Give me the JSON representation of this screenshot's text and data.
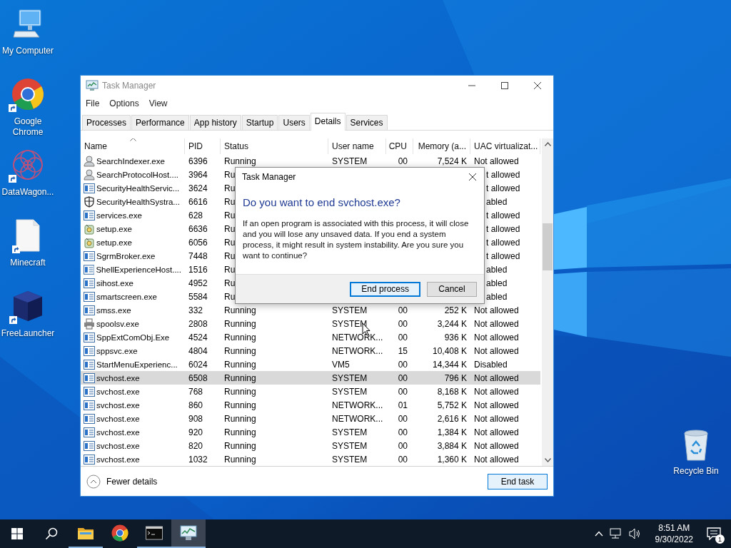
{
  "desktop_icons": [
    {
      "label": "My Computer",
      "kind": "computer",
      "shortcut": false
    },
    {
      "label": "Google Chrome",
      "kind": "chrome",
      "shortcut": true
    },
    {
      "label": "DataWagon...",
      "kind": "pattern",
      "shortcut": true
    },
    {
      "label": "Minecraft",
      "kind": "file",
      "shortcut": true
    },
    {
      "label": "FreeLauncher",
      "kind": "cube",
      "shortcut": true
    }
  ],
  "recycle_bin": {
    "label": "Recycle Bin"
  },
  "window": {
    "title": "Task Manager",
    "menu": [
      "File",
      "Options",
      "View"
    ],
    "tabs": [
      {
        "label": "Processes",
        "selected": false
      },
      {
        "label": "Performance",
        "selected": false
      },
      {
        "label": "App history",
        "selected": false
      },
      {
        "label": "Startup",
        "selected": false
      },
      {
        "label": "Users",
        "selected": false
      },
      {
        "label": "Details",
        "selected": true
      },
      {
        "label": "Services",
        "selected": false
      }
    ],
    "columns": [
      {
        "label": "Name",
        "sorted": true
      },
      {
        "label": "PID",
        "sorted": false
      },
      {
        "label": "Status",
        "sorted": false
      },
      {
        "label": "User name",
        "sorted": false
      },
      {
        "label": "CPU",
        "sorted": false
      },
      {
        "label": "Memory (a...",
        "sorted": false
      },
      {
        "label": "UAC virtualizat...",
        "sorted": false
      }
    ],
    "rows": [
      {
        "kind": "search",
        "name": "SearchIndexer.exe",
        "pid": "6396",
        "status": "Running",
        "user": "SYSTEM",
        "cpu": "00",
        "memory": "7,524 K",
        "uac": "Not allowed",
        "selected": false
      },
      {
        "kind": "search",
        "name": "SearchProtocolHost....",
        "pid": "3964",
        "status": "Ru",
        "uac": "t allowed",
        "selected": false
      },
      {
        "kind": "app",
        "name": "SecurityHealthServic...",
        "pid": "3624",
        "status": "Ru",
        "uac": "t allowed",
        "selected": false
      },
      {
        "kind": "shield",
        "name": "SecurityHealthSystra...",
        "pid": "6616",
        "status": "Ru",
        "uac": "abled",
        "selected": false
      },
      {
        "kind": "app",
        "name": "services.exe",
        "pid": "628",
        "status": "Ru",
        "uac": "t allowed",
        "selected": false
      },
      {
        "kind": "setup",
        "name": "setup.exe",
        "pid": "6636",
        "status": "Ru",
        "uac": "t allowed",
        "selected": false
      },
      {
        "kind": "setup",
        "name": "setup.exe",
        "pid": "6056",
        "status": "Ru",
        "uac": "t allowed",
        "selected": false
      },
      {
        "kind": "app",
        "name": "SgrmBroker.exe",
        "pid": "7448",
        "status": "Ru",
        "uac": "t allowed",
        "selected": false
      },
      {
        "kind": "app",
        "name": "ShellExperienceHost....",
        "pid": "1516",
        "status": "Ru",
        "uac": "abled",
        "selected": false
      },
      {
        "kind": "app",
        "name": "sihost.exe",
        "pid": "4952",
        "status": "Ru",
        "uac": "abled",
        "selected": false
      },
      {
        "kind": "app",
        "name": "smartscreen.exe",
        "pid": "5584",
        "status": "Ru",
        "uac": "abled",
        "selected": false
      },
      {
        "kind": "app",
        "name": "smss.exe",
        "pid": "332",
        "status": "Running",
        "user": "SYSTEM",
        "cpu": "00",
        "memory": "252 K",
        "uac": "Not allowed",
        "selected": false
      },
      {
        "kind": "printer",
        "name": "spoolsv.exe",
        "pid": "2808",
        "status": "Running",
        "user": "SYSTEM",
        "cpu": "00",
        "memory": "3,244 K",
        "uac": "Not allowed",
        "selected": false
      },
      {
        "kind": "app",
        "name": "SppExtComObj.Exe",
        "pid": "4524",
        "status": "Running",
        "user": "NETWORK...",
        "cpu": "00",
        "memory": "936 K",
        "uac": "Not allowed",
        "selected": false
      },
      {
        "kind": "app",
        "name": "sppsvc.exe",
        "pid": "4804",
        "status": "Running",
        "user": "NETWORK...",
        "cpu": "15",
        "memory": "10,408 K",
        "uac": "Not allowed",
        "selected": false
      },
      {
        "kind": "app",
        "name": "StartMenuExperienc...",
        "pid": "6024",
        "status": "Running",
        "user": "VM5",
        "cpu": "00",
        "memory": "14,344 K",
        "uac": "Disabled",
        "selected": false
      },
      {
        "kind": "app",
        "name": "svchost.exe",
        "pid": "6508",
        "status": "Running",
        "user": "SYSTEM",
        "cpu": "00",
        "memory": "796 K",
        "uac": "Not allowed",
        "selected": true
      },
      {
        "kind": "app",
        "name": "svchost.exe",
        "pid": "768",
        "status": "Running",
        "user": "SYSTEM",
        "cpu": "00",
        "memory": "8,168 K",
        "uac": "Not allowed",
        "selected": false
      },
      {
        "kind": "app",
        "name": "svchost.exe",
        "pid": "860",
        "status": "Running",
        "user": "NETWORK...",
        "cpu": "01",
        "memory": "5,752 K",
        "uac": "Not allowed",
        "selected": false
      },
      {
        "kind": "app",
        "name": "svchost.exe",
        "pid": "908",
        "status": "Running",
        "user": "NETWORK...",
        "cpu": "00",
        "memory": "2,616 K",
        "uac": "Not allowed",
        "selected": false
      },
      {
        "kind": "app",
        "name": "svchost.exe",
        "pid": "920",
        "status": "Running",
        "user": "SYSTEM",
        "cpu": "00",
        "memory": "1,384 K",
        "uac": "Not allowed",
        "selected": false
      },
      {
        "kind": "app",
        "name": "svchost.exe",
        "pid": "820",
        "status": "Running",
        "user": "SYSTEM",
        "cpu": "00",
        "memory": "3,884 K",
        "uac": "Not allowed",
        "selected": false
      },
      {
        "kind": "app",
        "name": "svchost.exe",
        "pid": "1032",
        "status": "Running",
        "user": "SYSTEM",
        "cpu": "00",
        "memory": "1,360 K",
        "uac": "Not allowed",
        "selected": false
      }
    ],
    "fewer_details": "Fewer details",
    "end_task": "End task"
  },
  "dialog": {
    "title": "Task Manager",
    "heading": "Do you want to end svchost.exe?",
    "message": "If an open program is associated with this process, it will close and you will lose any unsaved data. If you end a system process, it might result in system instability. Are you sure you want to continue?",
    "buttons": [
      {
        "label": "End process",
        "selected": true
      },
      {
        "label": "Cancel",
        "selected": false
      }
    ]
  },
  "taskbar": {
    "apps": [
      {
        "kind": "folder",
        "running": true,
        "selected": false
      },
      {
        "kind": "chrome",
        "running": false,
        "selected": false
      },
      {
        "kind": "terminal",
        "running": true,
        "selected": false
      },
      {
        "kind": "taskmgr",
        "running": true,
        "selected": true
      }
    ],
    "time": "8:51 AM",
    "date": "9/30/2022",
    "notifications": "1"
  }
}
